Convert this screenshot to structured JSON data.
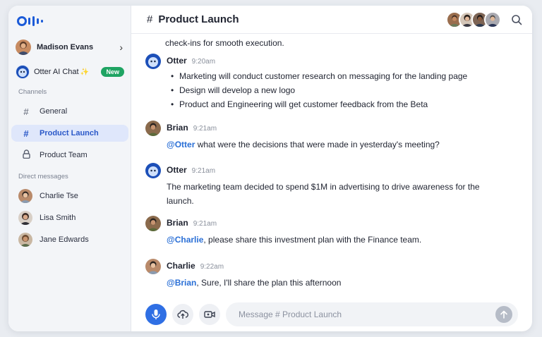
{
  "sidebar": {
    "user": {
      "name": "Madison Evans"
    },
    "otter_chat": {
      "label": "Otter AI Chat",
      "sparkle": "✨",
      "badge": "New"
    },
    "channels_label": "Channels",
    "channels": [
      {
        "label": "General",
        "icon": "hash-icon"
      },
      {
        "label": "Product Launch",
        "icon": "hash-icon",
        "active": true
      },
      {
        "label": "Product Team",
        "icon": "lock-icon"
      }
    ],
    "dm_label": "Direct messages",
    "direct_messages": [
      {
        "label": "Charlie Tse"
      },
      {
        "label": "Lisa Smith"
      },
      {
        "label": "Jane Edwards"
      }
    ]
  },
  "header": {
    "hash": "#",
    "title": "Product Launch"
  },
  "messages": {
    "continuation": "check-ins for smooth execution.",
    "items": [
      {
        "author": "Otter",
        "time": "9:20am",
        "bullets": [
          "Marketing will conduct customer research on messaging for the landing page",
          "Design will develop a new logo",
          "Product and Engineering will get customer feedback from the Beta"
        ]
      },
      {
        "author": "Brian",
        "time": "9:21am",
        "mention": "@Otter",
        "text": " what were the decisions that were made in yesterday's meeting?"
      },
      {
        "author": "Otter",
        "time": "9:21am",
        "text": "The marketing team decided to spend $1M in advertising to drive awareness for the launch."
      },
      {
        "author": "Brian",
        "time": "9:21am",
        "mention": "@Charlie",
        "text": ", please share this investment plan with the Finance team."
      },
      {
        "author": "Charlie",
        "time": "9:22am",
        "mention": "@Brian",
        "text": ", Sure, I'll share the plan this afternoon"
      }
    ]
  },
  "composer": {
    "placeholder": "Message # Product Launch"
  },
  "colors": {
    "accent": "#2f6fe4",
    "active_bg": "#dfe7fb",
    "badge": "#1fa463",
    "mention": "#2a6fd6"
  }
}
